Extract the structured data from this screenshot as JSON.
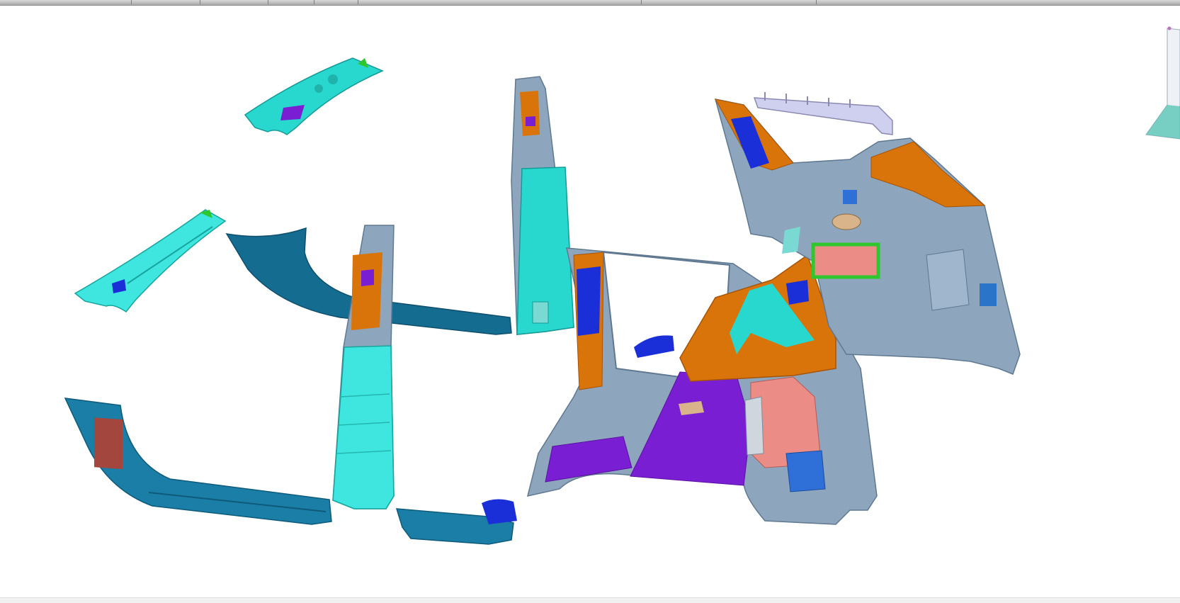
{
  "window": {
    "toolbar_separators": 7
  },
  "viewport": {
    "background": "#ffffff",
    "part_colors": {
      "cyan": "#28d8cf",
      "light_cyan": "#3fe6e0",
      "teal_blue": "#1b7ea6",
      "dark_teal": "#156c91",
      "steel_grey": "#8ea6bd",
      "light_grey": "#b7c7d6",
      "orange": "#d9740b",
      "royal_blue": "#1a2fd8",
      "purple": "#7a1ed4",
      "salmon": "#ec8c86",
      "red_brown": "#a3463e",
      "green": "#2ec82e",
      "lavender": "#cfcff0"
    },
    "parts": [
      "a-pillar-upper-trim",
      "a-pillar-lower-trim",
      "front-sill-scuff-plate",
      "b-pillar-lower-trim",
      "b-pillar-upper-trim",
      "center-sill-scuff-plate",
      "c-pillar-trim",
      "rear-quarter-trim-panel",
      "rear-wheelhouse-trim",
      "d-pillar-trim",
      "roof-rail-bracket"
    ],
    "triad_icon": "compass-triad-icon"
  }
}
